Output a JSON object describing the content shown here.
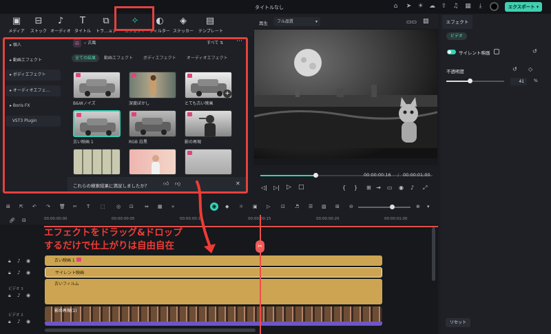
{
  "titlebar": {
    "title": "タイトルなし",
    "export": "エクスポート"
  },
  "tabs": [
    {
      "label": "メディア",
      "icon": "media-icon"
    },
    {
      "label": "ストック",
      "icon": "stock-icon"
    },
    {
      "label": "オーディオ",
      "icon": "audio-icon"
    },
    {
      "label": "タイトル",
      "icon": "title-icon"
    },
    {
      "label": "トラ…ョン",
      "icon": "transition-icon"
    },
    {
      "label": "エフェクト",
      "icon": "effects-icon"
    },
    {
      "label": "フィルター",
      "icon": "filter-icon"
    },
    {
      "label": "ステッカー",
      "icon": "sticker-icon"
    },
    {
      "label": "テンプレート",
      "icon": "template-icon"
    }
  ],
  "sidebar": {
    "items": [
      "個人",
      "動画エフェクト",
      "ボディエフェクト",
      "オーディオエフェ…",
      "Boris FX",
      "VST3 Plugin"
    ]
  },
  "search": {
    "value": "古風",
    "all": "すべて"
  },
  "filters": [
    "全ての結果",
    "動画エフェクト",
    "ボディエフェクト",
    "オーディオエフェクト"
  ],
  "effects": [
    {
      "label": "B&Wノイズ"
    },
    {
      "label": "深度ぼかし"
    },
    {
      "label": "とても古い映画"
    },
    {
      "label": "古い映画 1"
    },
    {
      "label": "RGB 白黒"
    },
    {
      "label": "影の再現"
    },
    {
      "label": ""
    },
    {
      "label": ""
    },
    {
      "label": ""
    }
  ],
  "feedback": {
    "text": "これらの検索結果に満足しましたか？"
  },
  "preview": {
    "play_label": "再生",
    "quality": "フル品質",
    "current_time": "00:00:00:16",
    "total_time": "00:00:01:00",
    "progress": 0.32
  },
  "inspector": {
    "tab": "エフェクト",
    "subtab": "ビデオ",
    "effect_name": "サイレント映画",
    "opacity_label": "不透明度",
    "opacity_value": "41",
    "opacity_unit": "%",
    "reset": "リセット"
  },
  "timeline": {
    "times": [
      "00:00:00:00",
      "00:00:00:05",
      "00:00:00:10",
      "00:00:00:15",
      "00:00:00:20",
      "00:00:01:00"
    ],
    "tracks": [
      {
        "label": "古い映画 1"
      },
      {
        "label": "サイレント映画"
      },
      {
        "label": "古いフィルム"
      },
      {
        "label": "影の再現(1)"
      }
    ],
    "track_labels": [
      "ビデオ 3",
      "ビデオ 2"
    ]
  },
  "overlay": {
    "line1": "エフェクトをドラッグ&ドロップ",
    "line2": "するだけで仕上がりは自由自在"
  },
  "colors": {
    "accent": "#35d4b8",
    "highlight": "#e5413e",
    "track": "#cda552"
  }
}
